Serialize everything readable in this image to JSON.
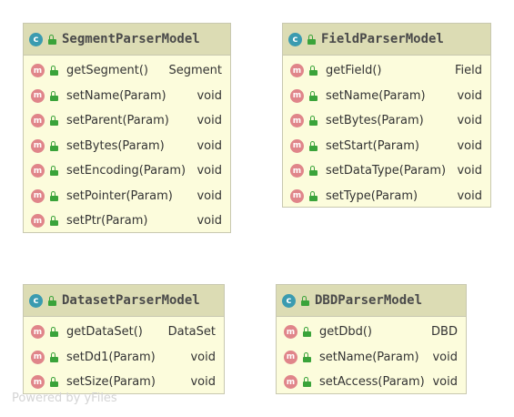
{
  "classes": [
    {
      "name": "SegmentParserModel",
      "members": [
        {
          "name": "getSegment()",
          "type": "Segment"
        },
        {
          "name": "setName(Param)",
          "type": "void"
        },
        {
          "name": "setParent(Param)",
          "type": "void"
        },
        {
          "name": "setBytes(Param)",
          "type": "void"
        },
        {
          "name": "setEncoding(Param)",
          "type": "void"
        },
        {
          "name": "setPointer(Param)",
          "type": "void"
        },
        {
          "name": "setPtr(Param)",
          "type": "void"
        }
      ]
    },
    {
      "name": "FieldParserModel",
      "members": [
        {
          "name": "getField()",
          "type": "Field"
        },
        {
          "name": "setName(Param)",
          "type": "void"
        },
        {
          "name": "setBytes(Param)",
          "type": "void"
        },
        {
          "name": "setStart(Param)",
          "type": "void"
        },
        {
          "name": "setDataType(Param)",
          "type": "void"
        },
        {
          "name": "setType(Param)",
          "type": "void"
        }
      ]
    },
    {
      "name": "DatasetParserModel",
      "members": [
        {
          "name": "getDataSet()",
          "type": "DataSet"
        },
        {
          "name": "setDd1(Param)",
          "type": "void"
        },
        {
          "name": "setSize(Param)",
          "type": "void"
        }
      ]
    },
    {
      "name": "DBDParserModel",
      "members": [
        {
          "name": "getDbd()",
          "type": "DBD"
        },
        {
          "name": "setName(Param)",
          "type": "void"
        },
        {
          "name": "setAccess(Param)",
          "type": "void"
        }
      ]
    }
  ],
  "badges": {
    "class": "c",
    "method": "m"
  },
  "icons": {
    "class_badge": "class-icon",
    "method_badge": "method-icon",
    "visibility": "public-lock-icon"
  },
  "colors": {
    "header": "#dcdcb4",
    "body": "#fcfcdc",
    "class_badge": "#3a9bb0",
    "method_badge": "#e0858a",
    "lock": "#3aa33a"
  },
  "watermark": "Powered by yFiles"
}
